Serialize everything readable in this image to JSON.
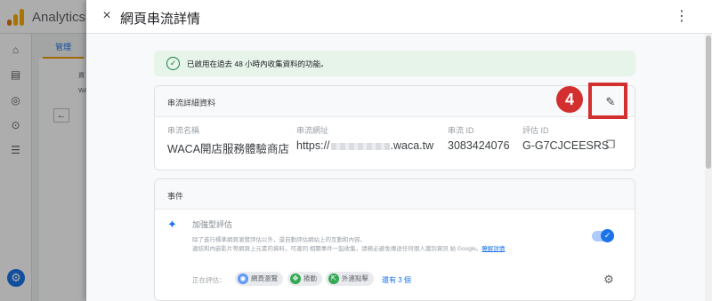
{
  "background": {
    "app_title": "Analytics (",
    "admin_tab": "管理",
    "snippets": [
      "資",
      "WA"
    ],
    "icons": [
      "home-icon",
      "reports-icon",
      "explore-icon",
      "advertising-icon",
      "list-icon",
      "settings-icon"
    ]
  },
  "drawer": {
    "close_icon": "×",
    "title": "網頁串流詳情",
    "more_icon": "⋮"
  },
  "banner": {
    "text": "已啟用在過去 48 小時內收集資料的功能。"
  },
  "stream_details": {
    "heading": "串流詳細資料",
    "edit_icon": "✎",
    "step_badge": "4",
    "fields": [
      {
        "label": "串流名稱",
        "value": "WACA開店服務體驗商店"
      },
      {
        "label": "串流網址",
        "value_prefix": "https://",
        "value_suffix": ".waca.tw"
      },
      {
        "label": "串流 ID",
        "value": "3083424076"
      },
      {
        "label": "評估 ID",
        "value": "G-G7CJCEESRS"
      }
    ]
  },
  "events": {
    "heading": "事件",
    "enhanced": {
      "title": "加強型評估",
      "description": "除了進行標準網頁瀏覽評估以外，還自動評估網站上的互動和內容。",
      "description2": "連結和內嵌影片等網頁上元素的資料，可連同 相關事件一起收集，請務必避免傳送任何個人識別資訊 給 Google。",
      "link_text": "瞭解詳情",
      "toggle_on": true
    },
    "measuring_label": "正在評估：",
    "chips": [
      "網頁瀏覽",
      "捲動",
      "外連點擊"
    ],
    "more_link": "還有 3 個"
  },
  "colors": {
    "accent": "#1a73e8",
    "highlight": "#d32f2f",
    "banner_bg": "#e6f4ea",
    "success": "#188038"
  }
}
